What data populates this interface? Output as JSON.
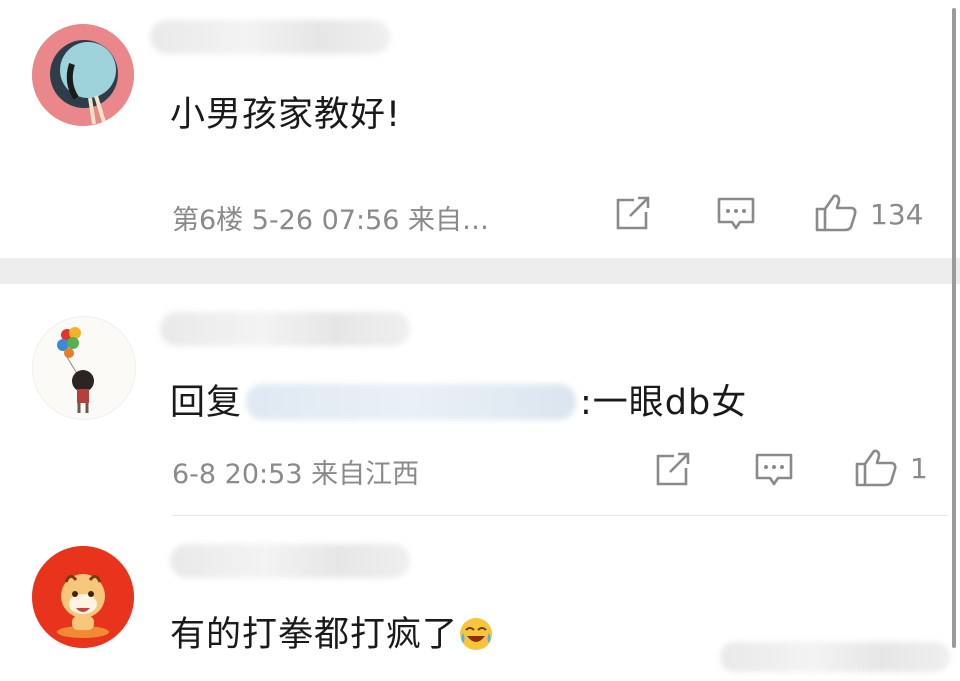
{
  "comments": [
    {
      "text": "小男孩家教好!",
      "meta": "第6楼 5-26 07:56 来自…",
      "likes": "134"
    },
    {
      "reply_prefix": "回复",
      "reply_suffix": ":一眼db女",
      "meta": "6-8 20:53 来自江西",
      "likes": "1"
    },
    {
      "text": "有的打拳都打疯了"
    }
  ],
  "icons": {
    "share": "share-icon",
    "comment": "comment-icon",
    "like": "thumbs-up-icon",
    "emoji": "laugh-cry-emoji"
  },
  "colors": {
    "text": "#1a1a1a",
    "meta": "#8a8a8a",
    "divider": "#ededed",
    "avatar1": "#e9878a",
    "avatar3": "#e8341c"
  }
}
